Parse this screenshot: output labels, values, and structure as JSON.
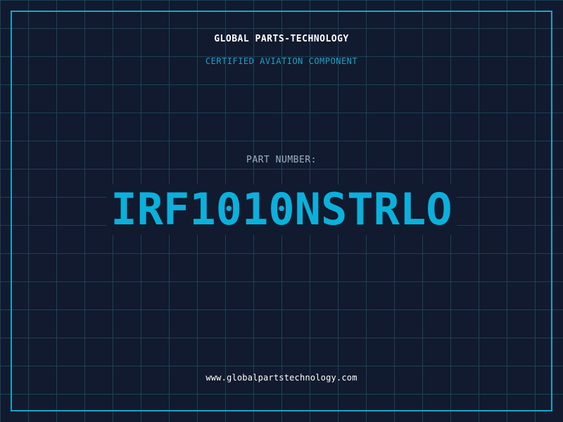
{
  "header": {
    "company_name": "GLOBAL PARTS-TECHNOLOGY",
    "tagline": "CERTIFIED AVIATION COMPONENT"
  },
  "part": {
    "label": "PART NUMBER:",
    "number": "IRF1010NSTRLO"
  },
  "footer": {
    "url": "www.globalpartstechnology.com"
  },
  "colors": {
    "background": "#111a2e",
    "grid": "#1d4157",
    "accent": "#0bb0dc",
    "frame": "#1aa3cc",
    "label": "#9eb0c4",
    "text": "#ffffff"
  }
}
